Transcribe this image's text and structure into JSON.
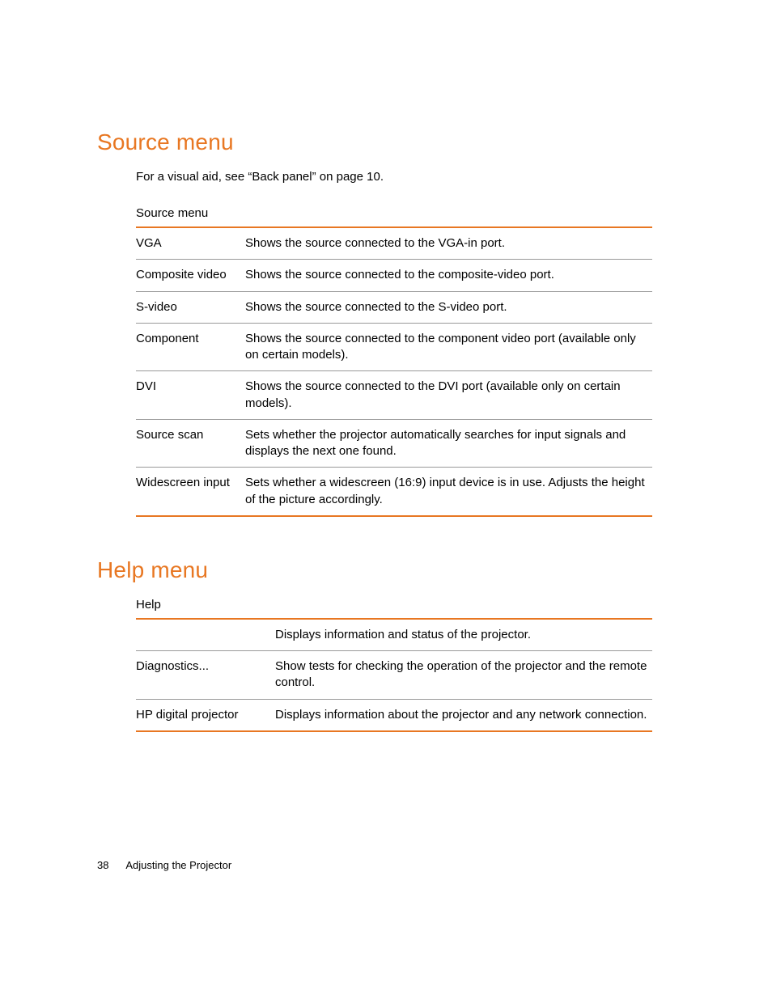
{
  "sections": {
    "source": {
      "heading": "Source menu",
      "intro": "For a visual aid, see “Back panel” on page 10.",
      "table_title": "Source menu",
      "rows": [
        {
          "label": "VGA",
          "desc": "Shows the source connected to the VGA-in port."
        },
        {
          "label": "Composite video",
          "desc": "Shows the source connected to the composite-video port."
        },
        {
          "label": "S-video",
          "desc": "Shows the source connected to the S-video port."
        },
        {
          "label": "Component",
          "desc": "Shows the source connected to the component video port (available only on certain models)."
        },
        {
          "label": "DVI",
          "desc": "Shows the source connected to the DVI port (available only on certain models)."
        },
        {
          "label": "Source scan",
          "desc": "Sets whether the projector automatically searches for input signals and displays the next one found."
        },
        {
          "label": "Widescreen input",
          "desc": "Sets whether a widescreen (16:9) input device is in use. Adjusts the height of the picture accordingly."
        }
      ]
    },
    "help": {
      "heading": "Help menu",
      "table_title": "Help",
      "rows": [
        {
          "label": "",
          "desc": "Displays information and status of the projector."
        },
        {
          "label": "Diagnostics...",
          "desc": "Show tests for checking the operation of the projector and the remote control."
        },
        {
          "label": "HP digital projector",
          "desc": "Displays information about the projector and any network connection."
        }
      ]
    }
  },
  "footer": {
    "page_number": "38",
    "chapter": "Adjusting the Projector"
  }
}
